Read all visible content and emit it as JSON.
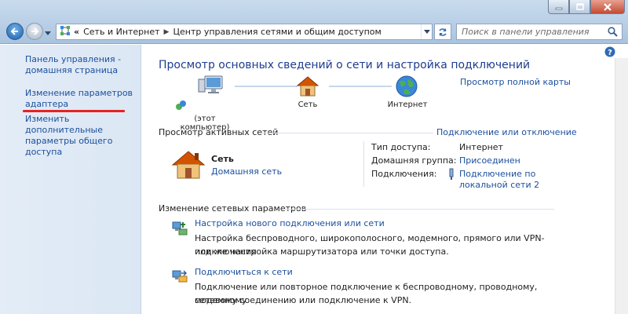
{
  "address_bar": {
    "crumbs": [
      "Сеть и Интернет",
      "Центр управления сетями и общим доступом"
    ],
    "overflow_marker": "«",
    "search_placeholder": "Поиск в панели управления"
  },
  "sidebar": {
    "links": [
      "Панель управления - домашняя страница",
      "Изменение параметров адаптера",
      "Изменить дополнительные параметры общего доступа"
    ],
    "highlight_color": "#e52323"
  },
  "main": {
    "title": "Просмотр основных сведений о сети и настройка подключений",
    "map_link": "Просмотр полной карты",
    "map": {
      "computer_label": "(этот компьютер)",
      "network_label": "Сеть",
      "internet_label": "Интернет"
    },
    "active_networks": {
      "title": "Просмотр активных сетей",
      "connect_link": "Подключение или отключение",
      "network_name": "Сеть",
      "network_type": "Домашняя сеть",
      "access_type_label": "Тип доступа:",
      "access_type_value": "Интернет",
      "homegroup_label": "Домашняя группа:",
      "homegroup_value": "Присоединен",
      "connections_label": "Подключения:",
      "connections_value_1": "Подключение по",
      "connections_value_2": "локальной сети 2"
    },
    "change_settings": {
      "title": "Изменение сетевых параметров",
      "tasks": [
        {
          "link": "Настройка нового подключения или сети",
          "desc_1": "Настройка беспроводного, широкополосного, модемного, прямого или VPN-подключения",
          "desc_2": "или же настройка маршрутизатора или точки доступа."
        },
        {
          "link": "Подключиться к сети",
          "desc_1": "Подключение или повторное подключение к беспроводному, проводному, модемному",
          "desc_2": "сетевому соединению или подключение к VPN."
        }
      ]
    }
  },
  "colors": {
    "link": "#1b4f9c",
    "title": "#1e3d8f",
    "chrome": "#b9cfe6",
    "sidebar": "#dbe7f4"
  }
}
